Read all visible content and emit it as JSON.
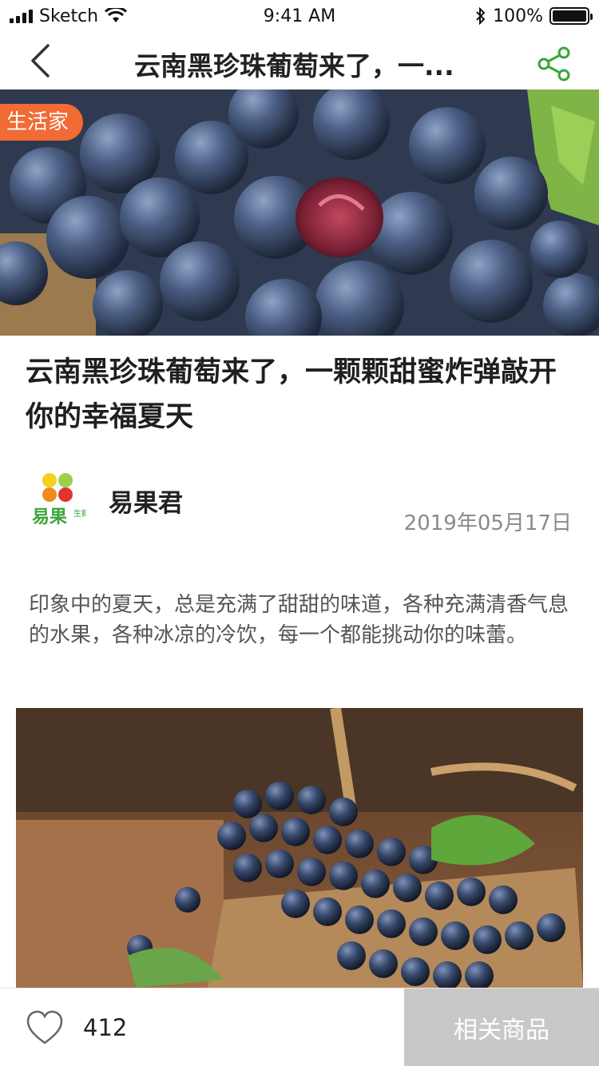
{
  "status_bar": {
    "carrier": "Sketch",
    "time": "9:41 AM",
    "battery": "100%",
    "battery_level": 1.0
  },
  "nav": {
    "title": "云南黑珍珠葡萄来了，一..."
  },
  "hero": {
    "badge": "生活家"
  },
  "article": {
    "title": "云南黑珍珠葡萄来了，一颗颗甜蜜炸弹敲开你的幸福夏天",
    "author": "易果君",
    "logo_text": "易果",
    "logo_sub": "生鲜",
    "date": "2019年05月17日",
    "intro": "印象中的夏天，总是充满了甜甜的味道，各种充满清香气息的水果，各种冰凉的冷饮，每一个都能挑动你的味蕾。"
  },
  "bottom_bar": {
    "like_count": "412",
    "related_label": "相关商品"
  },
  "colors": {
    "accent_green": "#3aa53a",
    "badge_orange": "#f26a34",
    "related_bg": "#c8c8c8"
  },
  "icons": {
    "back": "chevron-left-icon",
    "share": "share-icon",
    "like": "heart-icon",
    "wifi": "wifi-icon",
    "bluetooth": "bluetooth-icon"
  }
}
